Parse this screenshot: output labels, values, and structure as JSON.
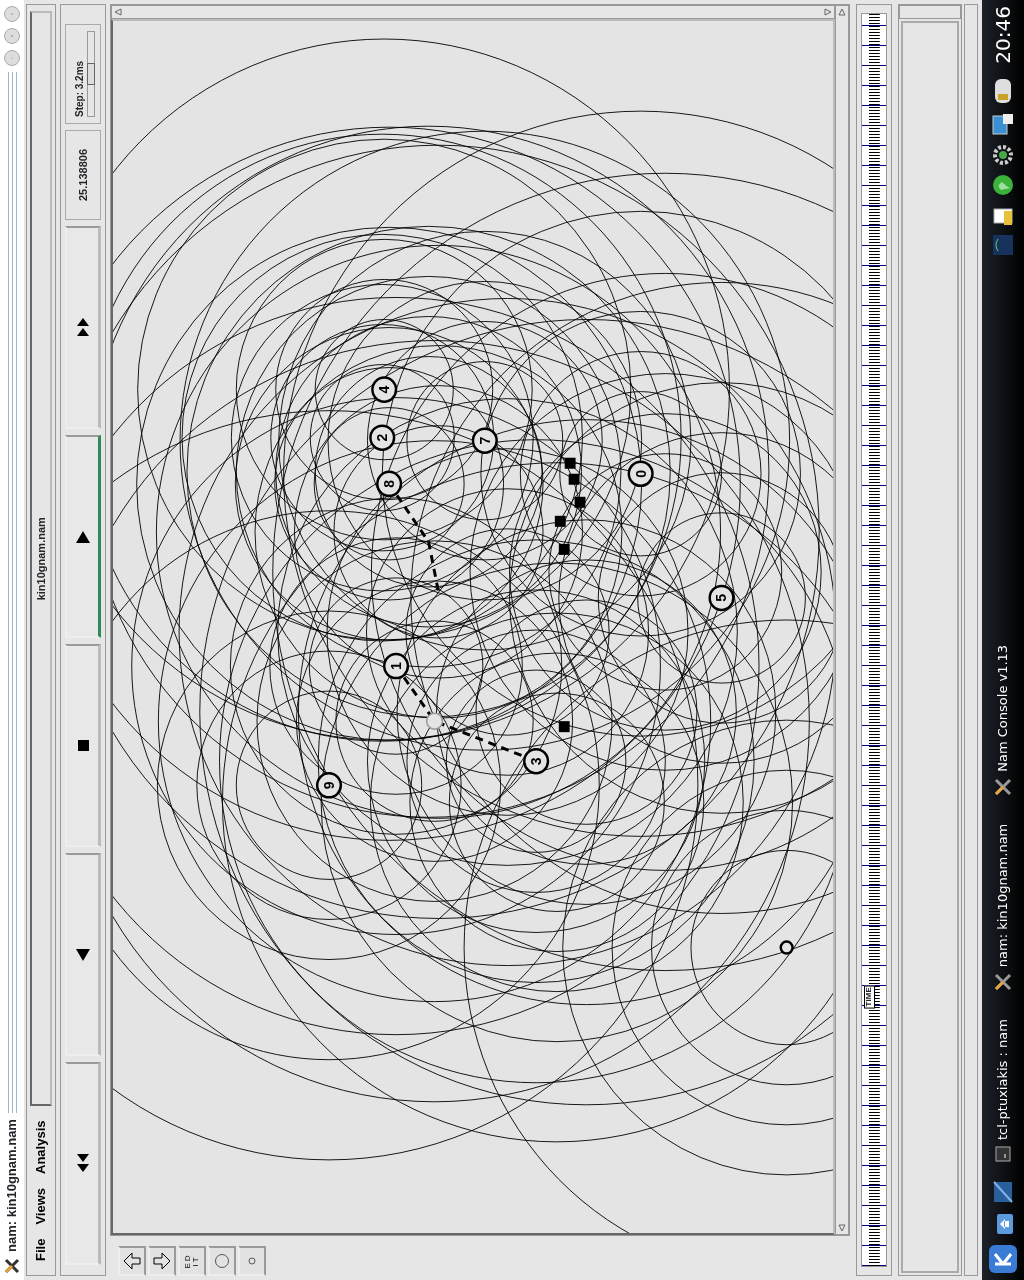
{
  "window": {
    "title": "nam: kin10gnam.nam"
  },
  "menu": [
    {
      "label": "File"
    },
    {
      "label": "Views"
    },
    {
      "label": "Analysis"
    }
  ],
  "trace_name": "kin10gnam.nam",
  "controls": [
    {
      "kind": "rewind",
      "selected": false
    },
    {
      "kind": "back",
      "selected": false
    },
    {
      "kind": "stop",
      "selected": false
    },
    {
      "kind": "play",
      "selected": true
    },
    {
      "kind": "fast_forward",
      "selected": false
    }
  ],
  "time_display": "25.138806",
  "step": {
    "label": "Step: 3.2ms",
    "level": 0.5
  },
  "tools": [
    {
      "kind": "up"
    },
    {
      "kind": "down"
    },
    {
      "kind": "edit",
      "label": "EDIT"
    },
    {
      "kind": "big_node"
    },
    {
      "kind": "small_node"
    }
  ],
  "nodes": [
    {
      "label": "4"
    },
    {
      "label": "2"
    },
    {
      "label": "8"
    },
    {
      "label": "7"
    },
    {
      "label": "0"
    },
    {
      "label": "5"
    },
    {
      "label": "1"
    },
    {
      "label": "3"
    },
    {
      "label": "9"
    }
  ],
  "time_slider": {
    "label": "TIME",
    "level": 0.215
  },
  "taskbar": {
    "tasks": [
      {
        "kind": "terminal",
        "label": "tcl-ptuxiakis : nam"
      },
      {
        "kind": "nam",
        "label": "nam: kin10gnam.nam"
      },
      {
        "kind": "nam",
        "label": "Nam Console v1.13"
      }
    ],
    "clock": "20:46"
  }
}
